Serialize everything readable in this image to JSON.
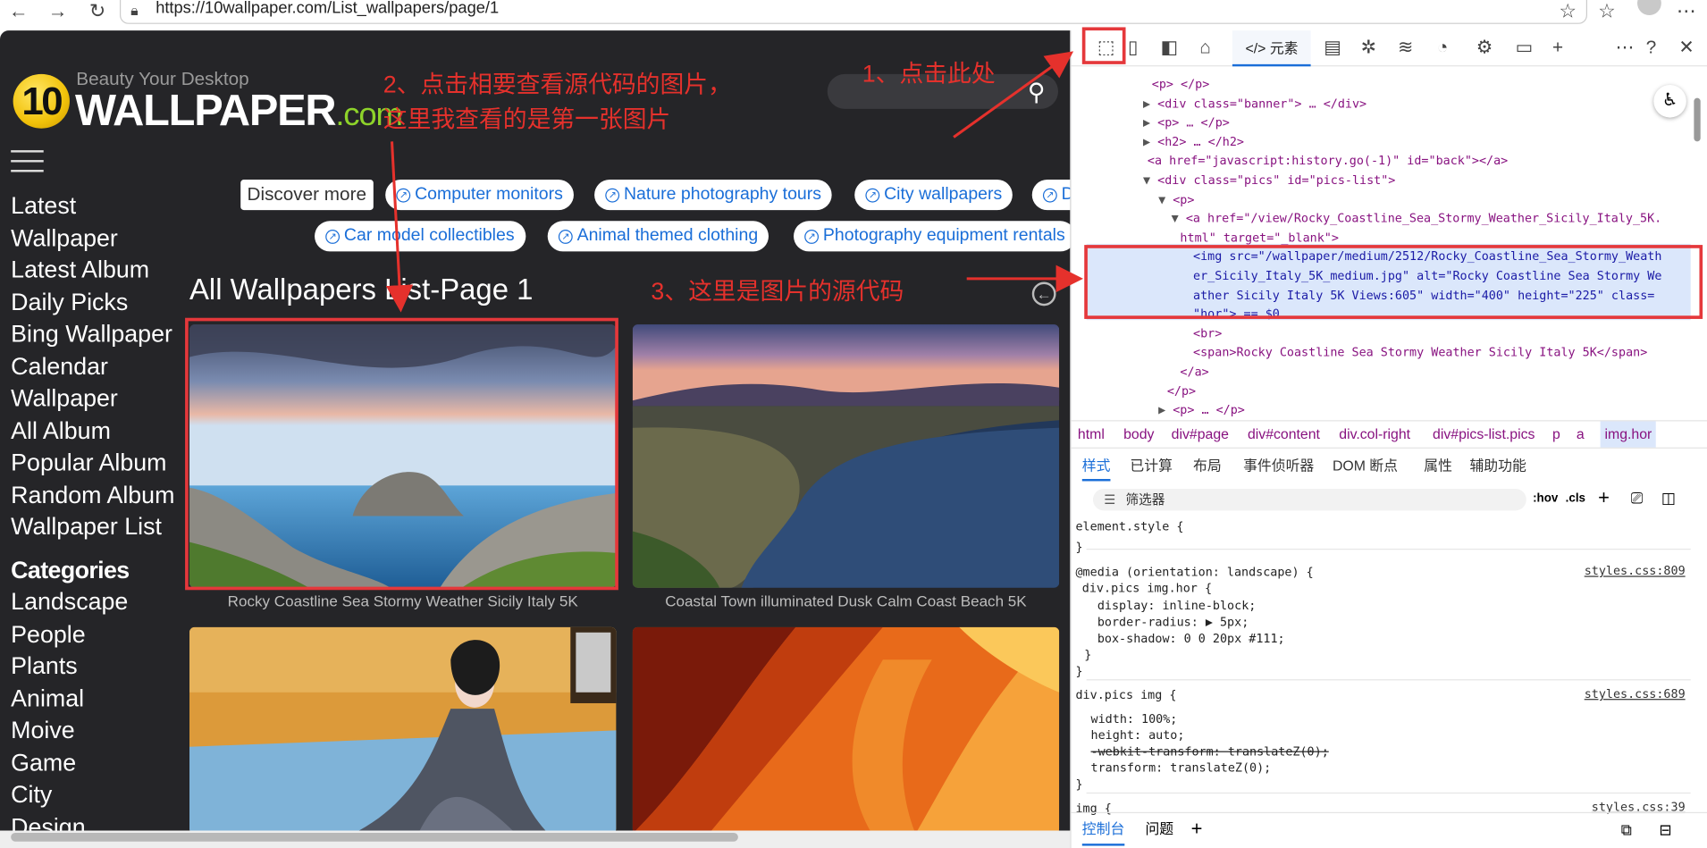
{
  "browser": {
    "url": "https://10wallpaper.com/List_wallpapers/page/1"
  },
  "site": {
    "logo": {
      "number": "10",
      "tagline": "Beauty Your Desktop",
      "name": "WALLPAPER",
      "tld": ".com"
    },
    "menu": [
      "Latest",
      "Wallpaper",
      "Latest Album",
      "Daily Picks",
      "Bing Wallpaper",
      "Calendar",
      "Wallpaper",
      "All Album",
      "Popular Album",
      "Random Album",
      "Wallpaper List"
    ],
    "categories_heading": "Categories",
    "categories": [
      "Landscape",
      "People",
      "Plants",
      "Animal",
      "Moive",
      "Game",
      "City",
      "Design"
    ],
    "discover": "Discover more",
    "pills": [
      "Computer monitors",
      "Nature photography tours",
      "City wallpapers",
      "D",
      "Car model collectibles",
      "Animal themed clothing",
      "Photography equipment rentals"
    ],
    "page_title": "All Wallpapers List-Page 1",
    "wallpapers": [
      {
        "caption": "Rocky Coastline Sea Stormy Weather Sicily Italy 5K"
      },
      {
        "caption": "Coastal Town illuminated Dusk Calm Coast Beach 5K"
      },
      {
        "caption": ""
      },
      {
        "caption": ""
      }
    ]
  },
  "devtools": {
    "elements_tab": "元素",
    "dom_lines": [
      {
        "t": "<p> </p>"
      },
      {
        "t": "<div class=\"banner\"> … </div>"
      },
      {
        "t": "<p> … </p>"
      },
      {
        "t": "<h2> … </h2>"
      },
      {
        "t": "<a href=\"javascript:history.go(-1)\" id=\"back\"></a>"
      },
      {
        "t": "<div class=\"pics\" id=\"pics-list\">"
      },
      {
        "t": "<p>"
      },
      {
        "t": "<a href=\"/view/Rocky_Coastline_Sea_Stormy_Weather_Sicily_Italy_5K."
      },
      {
        "t": "html\" target=\"_blank\">"
      },
      {
        "t": "<img src=\"/wallpaper/medium/2512/Rocky_Coastline_Sea_Stormy_Weath"
      },
      {
        "t": "er_Sicily_Italy_5K_medium.jpg\" alt=\"Rocky Coastline Sea Stormy We"
      },
      {
        "t": "ather Sicily Italy 5K Views:605\" width=\"400\" height=\"225\" class="
      },
      {
        "t": "\"hor\"> == $0"
      },
      {
        "t": "<br>"
      },
      {
        "t": "<span>Rocky Coastline Sea Stormy Weather Sicily Italy 5K</span>"
      },
      {
        "t": "</a>"
      },
      {
        "t": "</p>"
      },
      {
        "t": "<p> … </p>"
      }
    ],
    "breadcrumbs": [
      "html",
      "body",
      "div#page",
      "div#content",
      "div.col-right",
      "div#pics-list.pics",
      "p",
      "a",
      "img.hor"
    ],
    "style_tabs": [
      "样式",
      "已计算",
      "布局",
      "事件侦听器",
      "DOM 断点",
      "属性",
      "辅助功能"
    ],
    "filter_placeholder": "筛选器",
    "hov": ":hov",
    "cls": ".cls",
    "styles": [
      "element.style {",
      "}",
      "@media (orientation: landscape) {",
      "div.pics img.hor {",
      "display: inline-block;",
      "border-radius: ▶ 5px;",
      "box-shadow: 0 0 20px #111;",
      "}",
      "}",
      "div.pics img {",
      "width: 100%;",
      "height: auto;",
      "-webkit-transform: translateZ(0);",
      "transform: translateZ(0);",
      "}",
      "img {"
    ],
    "sources": [
      "styles.css:809",
      "styles.css:689",
      "styles.css:39"
    ],
    "bottom_tabs": [
      "控制台",
      "问题"
    ]
  },
  "annotations": {
    "step1": "1、点击此处",
    "step2_line1": "2、点击相要查看源代码的图片，",
    "step2_line2": "这里我查看的是第一张图片",
    "step3": "3、这里是图片的源代码"
  }
}
